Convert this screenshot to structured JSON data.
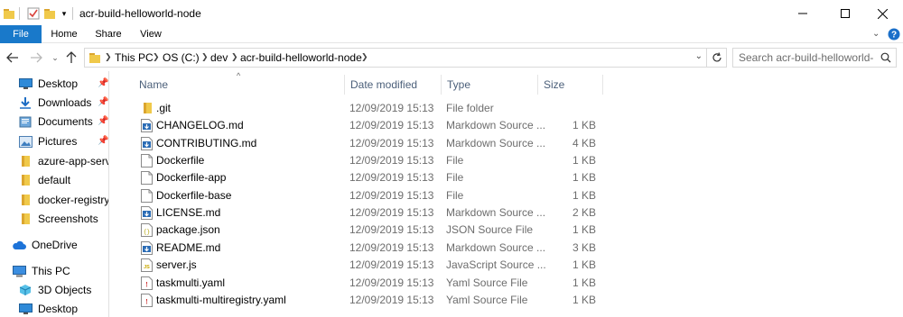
{
  "window": {
    "title": "acr-build-helloworld-node"
  },
  "ribbon": {
    "tabs": [
      "File",
      "Home",
      "Share",
      "View"
    ]
  },
  "address": {
    "crumbs": [
      "This PC",
      "OS (C:)",
      "dev",
      "acr-build-helloworld-node"
    ]
  },
  "search": {
    "placeholder": "Search acr-build-helloworld-n..."
  },
  "sidebar": {
    "items": [
      {
        "label": "Desktop",
        "icon": "desktop-icon",
        "pinned": true
      },
      {
        "label": "Downloads",
        "icon": "download-icon",
        "pinned": true
      },
      {
        "label": "Documents",
        "icon": "documents-icon",
        "pinned": true
      },
      {
        "label": "Pictures",
        "icon": "pictures-icon",
        "pinned": true
      },
      {
        "label": "azure-app-servic",
        "icon": "folder-icon",
        "pinned": false
      },
      {
        "label": "default",
        "icon": "folder-icon",
        "pinned": false
      },
      {
        "label": "docker-registry-l",
        "icon": "folder-icon",
        "pinned": false
      },
      {
        "label": "Screenshots",
        "icon": "folder-icon",
        "pinned": false
      },
      {
        "label": "OneDrive",
        "icon": "onedrive-icon",
        "pinned": false
      },
      {
        "label": "This PC",
        "icon": "computer-icon",
        "pinned": false
      },
      {
        "label": "3D Objects",
        "icon": "3d-objects-icon",
        "pinned": false
      },
      {
        "label": "Desktop",
        "icon": "desktop-icon",
        "pinned": false
      }
    ]
  },
  "columns": {
    "name": "Name",
    "date": "Date modified",
    "type": "Type",
    "size": "Size"
  },
  "files": [
    {
      "name": ".git",
      "date": "12/09/2019 15:13",
      "type": "File folder",
      "size": "",
      "icon": "folder-icon"
    },
    {
      "name": "CHANGELOG.md",
      "date": "12/09/2019 15:13",
      "type": "Markdown Source ...",
      "size": "1 KB",
      "icon": "markdown-file-icon"
    },
    {
      "name": "CONTRIBUTING.md",
      "date": "12/09/2019 15:13",
      "type": "Markdown Source ...",
      "size": "4 KB",
      "icon": "markdown-file-icon"
    },
    {
      "name": "Dockerfile",
      "date": "12/09/2019 15:13",
      "type": "File",
      "size": "1 KB",
      "icon": "file-icon"
    },
    {
      "name": "Dockerfile-app",
      "date": "12/09/2019 15:13",
      "type": "File",
      "size": "1 KB",
      "icon": "file-icon"
    },
    {
      "name": "Dockerfile-base",
      "date": "12/09/2019 15:13",
      "type": "File",
      "size": "1 KB",
      "icon": "file-icon"
    },
    {
      "name": "LICENSE.md",
      "date": "12/09/2019 15:13",
      "type": "Markdown Source ...",
      "size": "2 KB",
      "icon": "markdown-file-icon"
    },
    {
      "name": "package.json",
      "date": "12/09/2019 15:13",
      "type": "JSON Source File",
      "size": "1 KB",
      "icon": "json-file-icon"
    },
    {
      "name": "README.md",
      "date": "12/09/2019 15:13",
      "type": "Markdown Source ...",
      "size": "3 KB",
      "icon": "markdown-file-icon"
    },
    {
      "name": "server.js",
      "date": "12/09/2019 15:13",
      "type": "JavaScript Source ...",
      "size": "1 KB",
      "icon": "js-file-icon"
    },
    {
      "name": "taskmulti.yaml",
      "date": "12/09/2019 15:13",
      "type": "Yaml Source File",
      "size": "1 KB",
      "icon": "yaml-file-icon"
    },
    {
      "name": "taskmulti-multiregistry.yaml",
      "date": "12/09/2019 15:13",
      "type": "Yaml Source File",
      "size": "1 KB",
      "icon": "yaml-file-icon"
    }
  ],
  "colors": {
    "accent": "#1979ca",
    "folder": "#e8b83a",
    "header_text": "#4c607a",
    "muted_text": "#6d6d6d"
  }
}
